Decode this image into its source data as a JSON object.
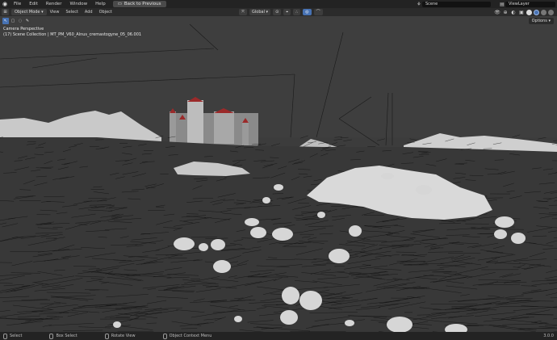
{
  "topbar": {
    "menus": [
      "File",
      "Edit",
      "Render",
      "Window",
      "Help"
    ],
    "back_button": "Back to Previous",
    "scene": "Scene",
    "view_layer": "ViewLayer"
  },
  "header": {
    "mode": "Object Mode",
    "menus": [
      "View",
      "Select",
      "Add",
      "Object"
    ],
    "transform_orientation": "Global",
    "options": "Options"
  },
  "viewport": {
    "camera_label": "Camera Perspective",
    "collection_label": "(17) Scene Collection | MT_PM_V60_Alnus_cremastogyne_05_06.001",
    "background_color": "#3c3c3c"
  },
  "statusbar": {
    "select": "Select",
    "box_select": "Box Select",
    "rotate_view": "Rotate View",
    "context_menu": "Object Context Menu",
    "version": "3.0.0"
  }
}
